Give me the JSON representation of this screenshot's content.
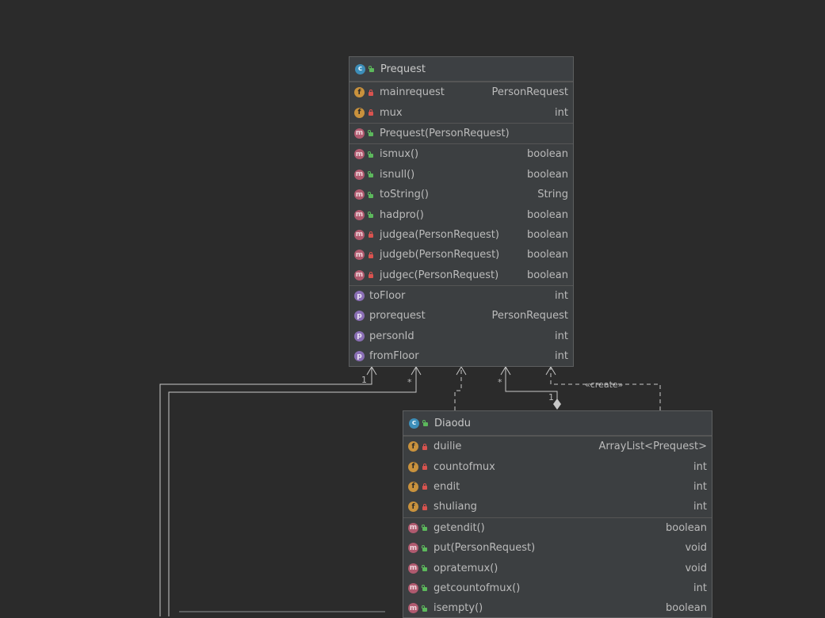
{
  "prequest": {
    "name": "Prequest",
    "fields": [
      {
        "name": "mainrequest",
        "type": "PersonRequest"
      },
      {
        "name": "mux",
        "type": "int"
      }
    ],
    "constructors": [
      {
        "name": "Prequest(PersonRequest)",
        "type": ""
      }
    ],
    "methods": [
      {
        "name": "ismux()",
        "type": "boolean",
        "visibility": "public"
      },
      {
        "name": "isnull()",
        "type": "boolean",
        "visibility": "public"
      },
      {
        "name": "toString()",
        "type": "String",
        "visibility": "public"
      },
      {
        "name": "hadpro()",
        "type": "boolean",
        "visibility": "public"
      },
      {
        "name": "judgea(PersonRequest)",
        "type": "boolean",
        "visibility": "private"
      },
      {
        "name": "judgeb(PersonRequest)",
        "type": "boolean",
        "visibility": "private"
      },
      {
        "name": "judgec(PersonRequest)",
        "type": "boolean",
        "visibility": "private"
      }
    ],
    "properties": [
      {
        "name": "toFloor",
        "type": "int"
      },
      {
        "name": "prorequest",
        "type": "PersonRequest"
      },
      {
        "name": "personId",
        "type": "int"
      },
      {
        "name": "fromFloor",
        "type": "int"
      }
    ]
  },
  "diaodu": {
    "name": "Diaodu",
    "fields": [
      {
        "name": "duilie",
        "type": "ArrayList<Prequest>"
      },
      {
        "name": "countofmux",
        "type": "int"
      },
      {
        "name": "endit",
        "type": "int"
      },
      {
        "name": "shuliang",
        "type": "int"
      }
    ],
    "methods": [
      {
        "name": "getendit()",
        "type": "boolean",
        "visibility": "public"
      },
      {
        "name": "put(PersonRequest)",
        "type": "void",
        "visibility": "public"
      },
      {
        "name": "opratemux()",
        "type": "void",
        "visibility": "public"
      },
      {
        "name": "getcountofmux()",
        "type": "int",
        "visibility": "public"
      },
      {
        "name": "isempty()",
        "type": "boolean",
        "visibility": "public"
      }
    ]
  },
  "edge_labels": {
    "mult_1_left": "1",
    "mult_star_left": "*",
    "mult_star_mid": "*",
    "mult_1_comp": "1",
    "create": "«create»"
  },
  "badges": {
    "class": "c",
    "field": "f",
    "method": "m",
    "property": "p"
  },
  "icons": [
    "class-icon",
    "field-icon",
    "method-icon",
    "property-icon",
    "lock-icon",
    "unlock-icon"
  ]
}
